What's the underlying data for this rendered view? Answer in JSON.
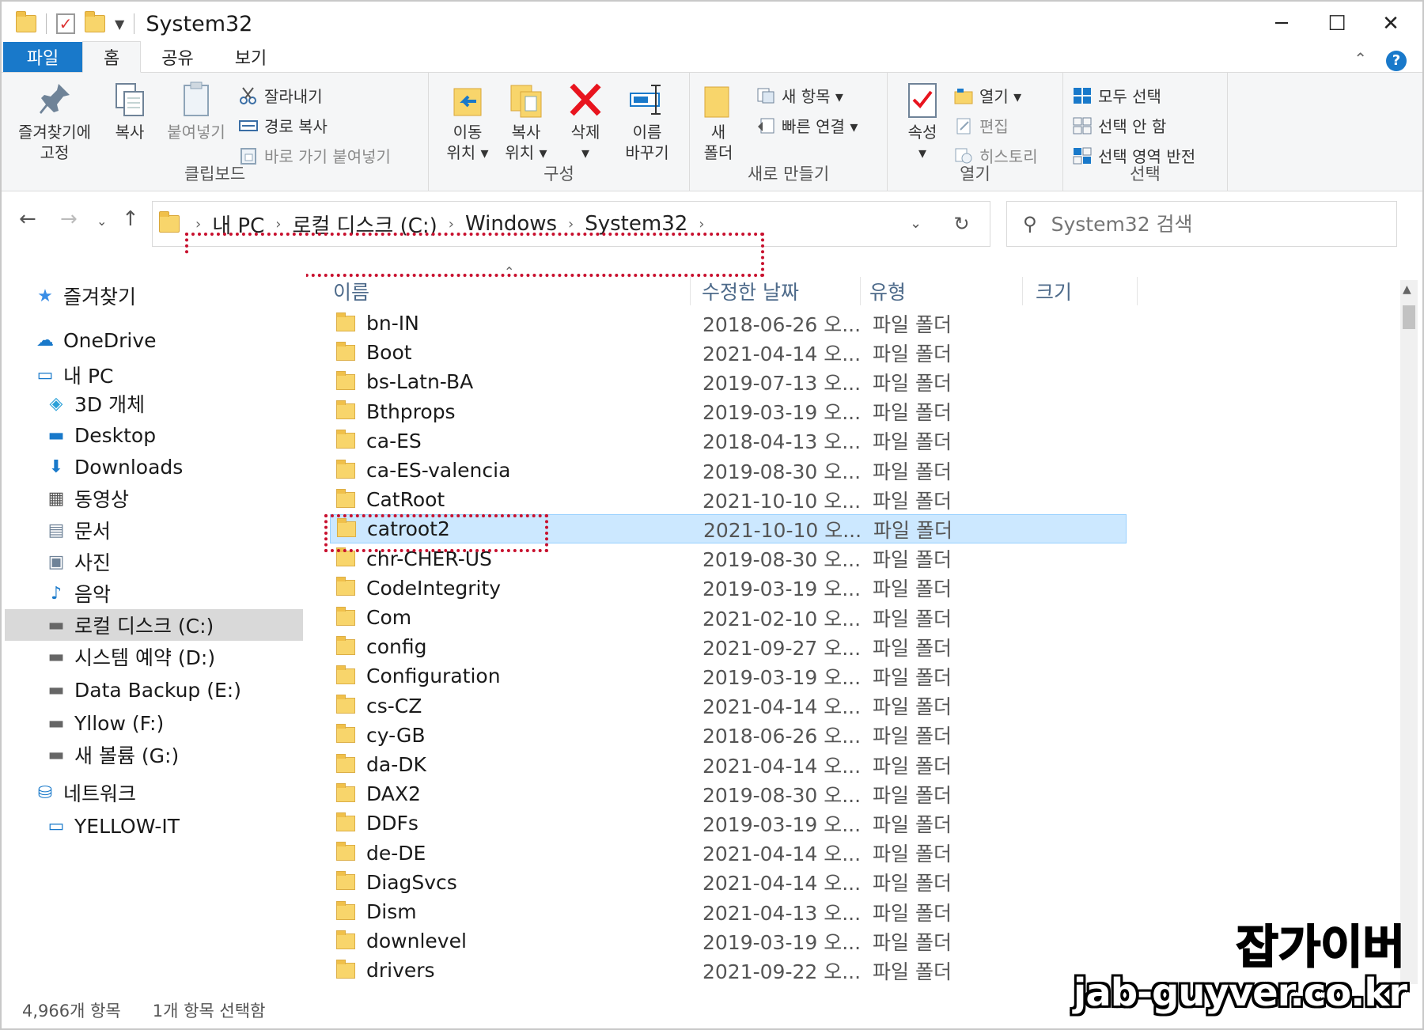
{
  "window": {
    "title": "System32",
    "controls": {
      "minimize": "─",
      "maximize": "☐",
      "close": "✕"
    }
  },
  "ribbon": {
    "tabs": [
      "파일",
      "홈",
      "공유",
      "보기"
    ],
    "groups": {
      "clipboard": {
        "label": "클립보드",
        "pin": "즐겨찾기에\n고정",
        "copy": "복사",
        "paste": "붙여넣기",
        "cut": "잘라내기",
        "copy_path": "경로 복사",
        "paste_shortcut": "바로 가기 붙여넣기"
      },
      "organize": {
        "label": "구성",
        "move_to": "이동\n위치 ▾",
        "copy_to": "복사\n위치 ▾",
        "delete": "삭제\n▾",
        "rename": "이름\n바꾸기"
      },
      "new": {
        "label": "새로 만들기",
        "new_folder": "새\n폴더",
        "new_item": "새 항목 ▾",
        "easy_access": "빠른 연결 ▾"
      },
      "open": {
        "label": "열기",
        "properties": "속성\n▾",
        "open": "열기 ▾",
        "edit": "편집",
        "history": "히스토리"
      },
      "select": {
        "label": "선택",
        "select_all": "모두 선택",
        "select_none": "선택 안 함",
        "invert": "선택 영역 반전"
      }
    }
  },
  "address": {
    "crumbs": [
      "내 PC",
      "로컬 디스크 (C:)",
      "Windows",
      "System32"
    ],
    "search_placeholder": "System32 검색"
  },
  "nav_pane": {
    "items": [
      {
        "label": "즐겨찾기",
        "icon": "star-icon"
      },
      {
        "label": "OneDrive",
        "icon": "cloud-icon"
      },
      {
        "label": "내 PC",
        "icon": "pc-icon"
      },
      {
        "label": "3D 개체",
        "icon": "cube-icon"
      },
      {
        "label": "Desktop",
        "icon": "desktop-icon"
      },
      {
        "label": "Downloads",
        "icon": "download-icon"
      },
      {
        "label": "동영상",
        "icon": "video-icon"
      },
      {
        "label": "문서",
        "icon": "document-icon"
      },
      {
        "label": "사진",
        "icon": "picture-icon"
      },
      {
        "label": "음악",
        "icon": "music-icon"
      },
      {
        "label": "로컬 디스크 (C:)",
        "icon": "drive-icon"
      },
      {
        "label": "시스템 예약 (D:)",
        "icon": "drive-icon"
      },
      {
        "label": "Data Backup (E:)",
        "icon": "drive-icon"
      },
      {
        "label": "Yllow (F:)",
        "icon": "drive-icon"
      },
      {
        "label": "새 볼륨 (G:)",
        "icon": "drive-icon"
      },
      {
        "label": "네트워크",
        "icon": "network-icon"
      },
      {
        "label": "YELLOW-IT",
        "icon": "computer-icon"
      }
    ]
  },
  "file_list": {
    "columns": [
      "이름",
      "수정한 날짜",
      "유형",
      "크기"
    ],
    "rows": [
      {
        "name": "bn-IN",
        "date": "2018-06-26 오...",
        "type": "파일 폴더"
      },
      {
        "name": "Boot",
        "date": "2021-04-14 오...",
        "type": "파일 폴더"
      },
      {
        "name": "bs-Latn-BA",
        "date": "2019-07-13 오...",
        "type": "파일 폴더"
      },
      {
        "name": "Bthprops",
        "date": "2019-03-19 오...",
        "type": "파일 폴더"
      },
      {
        "name": "ca-ES",
        "date": "2018-04-13 오...",
        "type": "파일 폴더"
      },
      {
        "name": "ca-ES-valencia",
        "date": "2019-08-30 오...",
        "type": "파일 폴더"
      },
      {
        "name": "CatRoot",
        "date": "2021-10-10 오...",
        "type": "파일 폴더"
      },
      {
        "name": "catroot2",
        "date": "2021-10-10 오...",
        "type": "파일 폴더"
      },
      {
        "name": "chr-CHER-US",
        "date": "2019-08-30 오...",
        "type": "파일 폴더"
      },
      {
        "name": "CodeIntegrity",
        "date": "2019-03-19 오...",
        "type": "파일 폴더"
      },
      {
        "name": "Com",
        "date": "2021-02-10 오...",
        "type": "파일 폴더"
      },
      {
        "name": "config",
        "date": "2021-09-27 오...",
        "type": "파일 폴더"
      },
      {
        "name": "Configuration",
        "date": "2019-03-19 오...",
        "type": "파일 폴더"
      },
      {
        "name": "cs-CZ",
        "date": "2021-04-14 오...",
        "type": "파일 폴더"
      },
      {
        "name": "cy-GB",
        "date": "2018-06-26 오...",
        "type": "파일 폴더"
      },
      {
        "name": "da-DK",
        "date": "2021-04-14 오...",
        "type": "파일 폴더"
      },
      {
        "name": "DAX2",
        "date": "2019-08-30 오...",
        "type": "파일 폴더"
      },
      {
        "name": "DDFs",
        "date": "2019-03-19 오...",
        "type": "파일 폴더"
      },
      {
        "name": "de-DE",
        "date": "2021-04-14 오...",
        "type": "파일 폴더"
      },
      {
        "name": "DiagSvcs",
        "date": "2021-04-14 오...",
        "type": "파일 폴더"
      },
      {
        "name": "Dism",
        "date": "2021-04-13 오...",
        "type": "파일 폴더"
      },
      {
        "name": "downlevel",
        "date": "2019-03-19 오...",
        "type": "파일 폴더"
      },
      {
        "name": "drivers",
        "date": "2021-09-22 오...",
        "type": "파일 폴더"
      }
    ],
    "selected_index": 7
  },
  "status": {
    "count": "4,966개 항목",
    "selection": "1개 항목 선택함"
  },
  "watermark": {
    "name": "잡가이버",
    "url": "jab-guyver.co.kr"
  },
  "colors": {
    "accent": "#1979ca",
    "selection": "#cce8ff",
    "highlight_box": "#c8102e",
    "folder": "#f8d56b"
  }
}
